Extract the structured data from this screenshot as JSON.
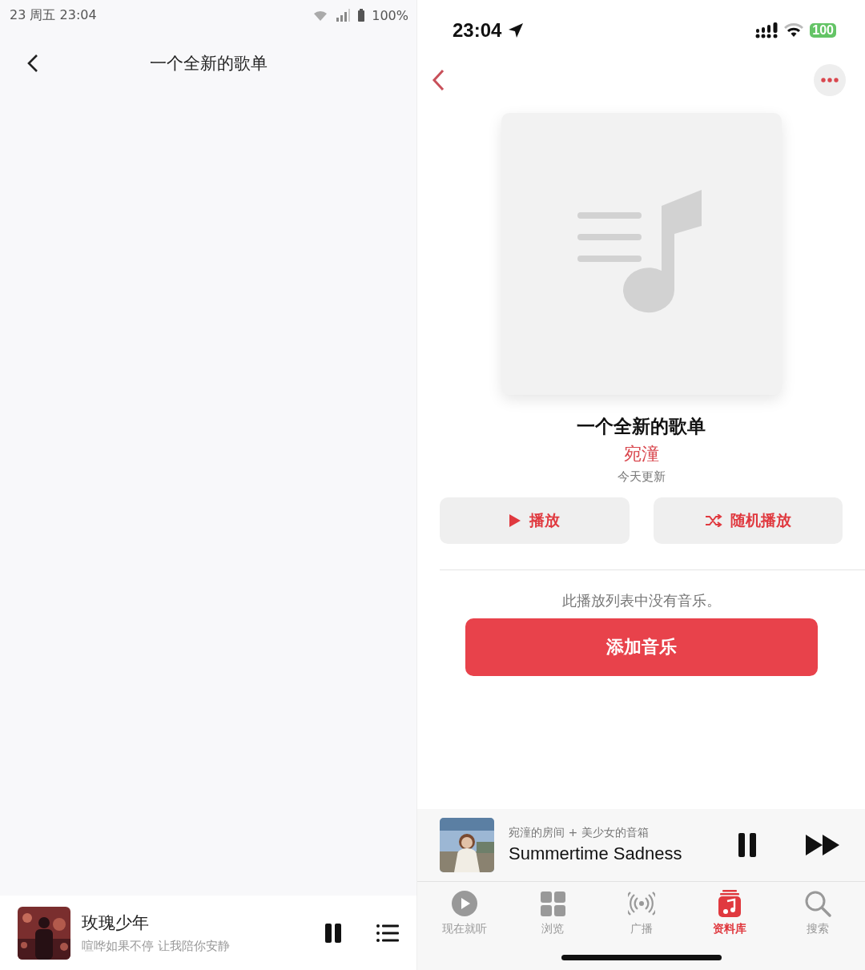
{
  "left": {
    "status_bar": {
      "time": "23 周五 23:04",
      "battery": "100%"
    },
    "header": {
      "title": "一个全新的歌单"
    },
    "now_playing": {
      "title": "玫瑰少年",
      "subtitle": "喧哗如果不停 让我陪你安静"
    }
  },
  "right": {
    "status_bar": {
      "time": "23:04",
      "battery": "100"
    },
    "playlist": {
      "title": "一个全新的歌单",
      "author": "宛潼",
      "updated": "今天更新"
    },
    "actions": [
      {
        "kind": "play",
        "label": "播放"
      },
      {
        "kind": "shuffle",
        "label": "随机播放"
      }
    ],
    "empty_message": "此播放列表中没有音乐。",
    "add_button": "添加音乐",
    "mini_player": {
      "source": "宛潼的房间 + 美少女的音箱",
      "title": "Summertime Sadness"
    },
    "tabs": [
      {
        "kind": "listen-now",
        "label": "现在就听",
        "selected": false
      },
      {
        "kind": "browse",
        "label": "浏览",
        "selected": false
      },
      {
        "kind": "radio",
        "label": "广播",
        "selected": false
      },
      {
        "kind": "library",
        "label": "资料库",
        "selected": true
      },
      {
        "kind": "search",
        "label": "搜索",
        "selected": false
      }
    ]
  }
}
